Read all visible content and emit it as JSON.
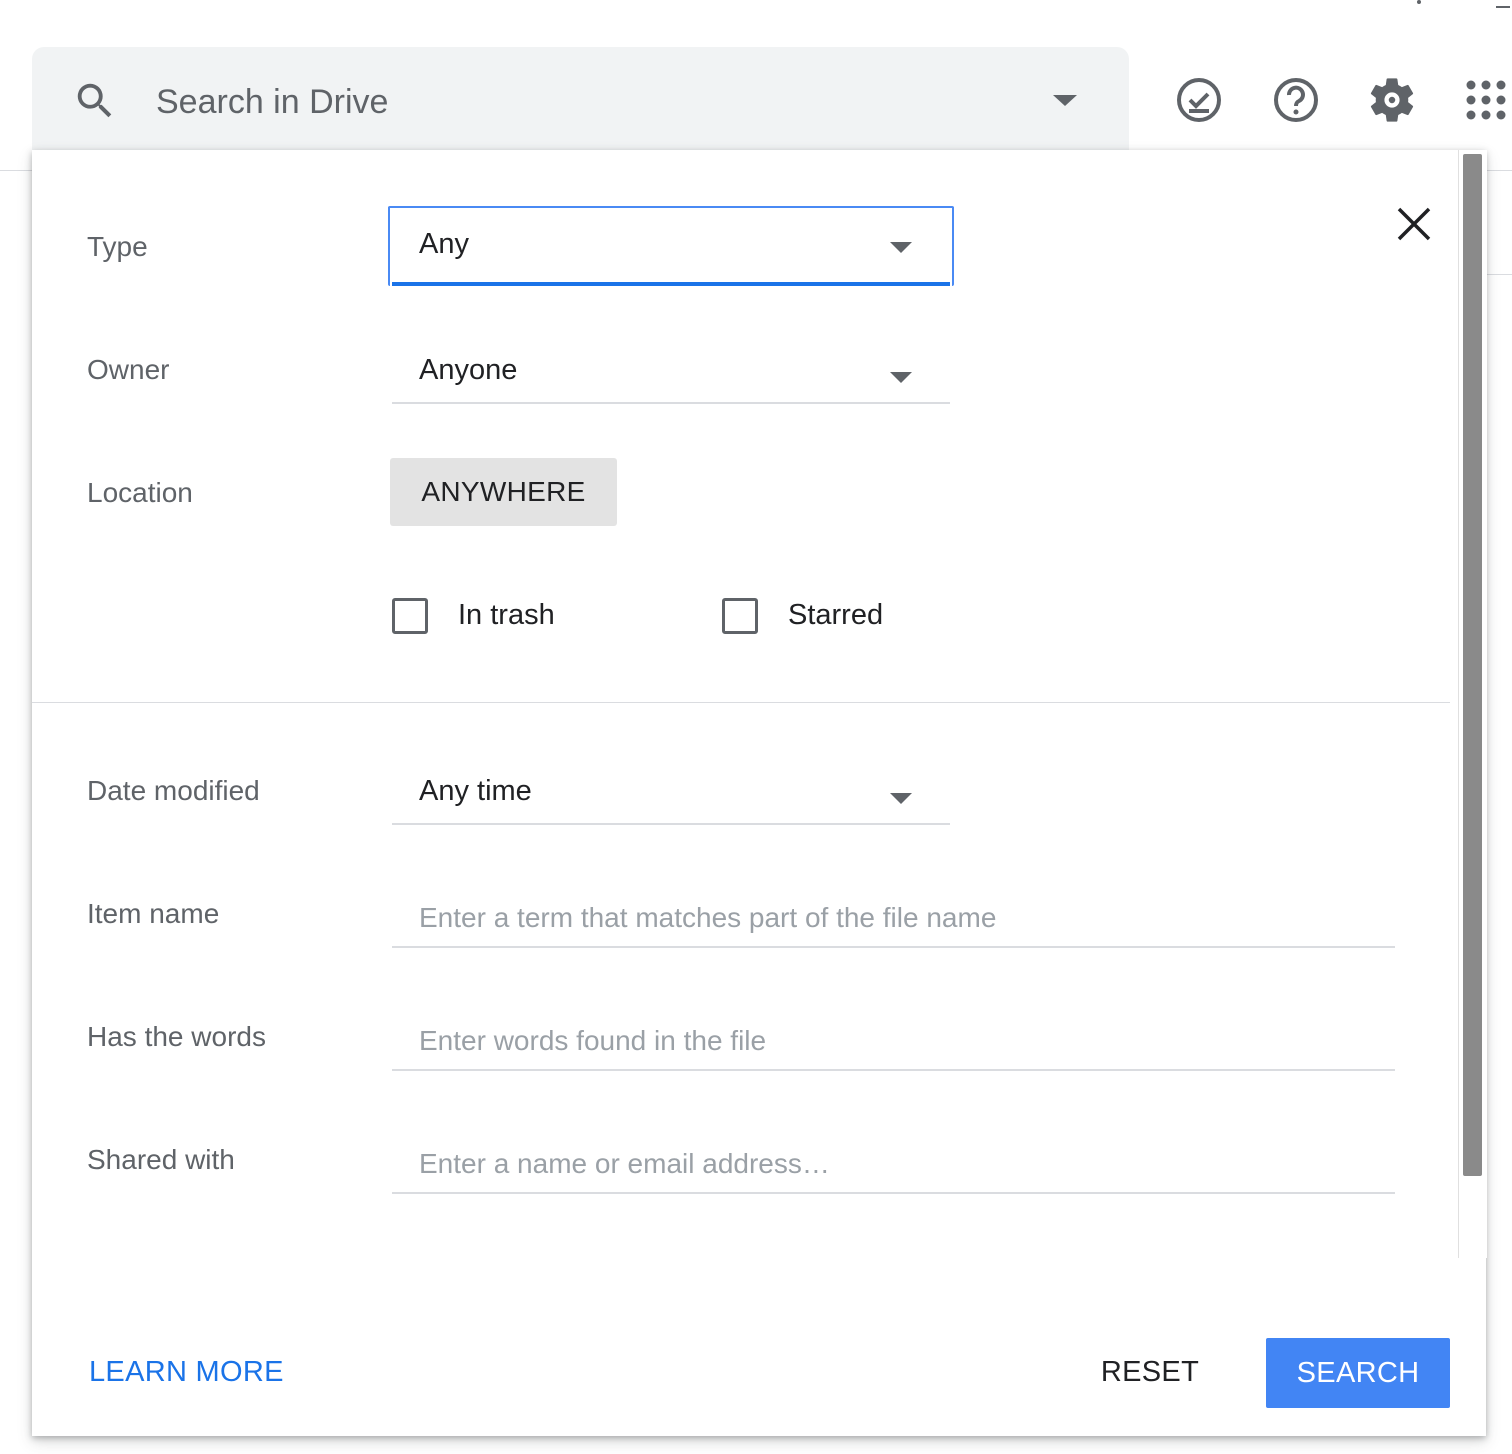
{
  "header": {
    "search_placeholder": "Search in Drive",
    "icons": [
      "search-icon",
      "search-options-caret-icon",
      "ready-for-offline-icon",
      "help-icon",
      "settings-gear-icon",
      "apps-grid-icon"
    ]
  },
  "dialog": {
    "type": {
      "label": "Type",
      "value": "Any"
    },
    "owner": {
      "label": "Owner",
      "value": "Anyone"
    },
    "location": {
      "label": "Location",
      "button": "ANYWHERE"
    },
    "checkboxes": {
      "in_trash": "In trash",
      "starred": "Starred"
    },
    "date_modified": {
      "label": "Date modified",
      "value": "Any time"
    },
    "item_name": {
      "label": "Item name",
      "placeholder": "Enter a term that matches part of the file name"
    },
    "has_words": {
      "label": "Has the words",
      "placeholder": "Enter words found in the file"
    },
    "shared_with": {
      "label": "Shared with",
      "placeholder": "Enter a name or email address…"
    },
    "footer": {
      "learn_more": "LEARN MORE",
      "reset": "RESET",
      "search": "SEARCH"
    }
  },
  "colors": {
    "accent": "#4285f4",
    "link": "#1a73e8",
    "label": "#5f6368",
    "placeholder": "#9aa0a6"
  }
}
